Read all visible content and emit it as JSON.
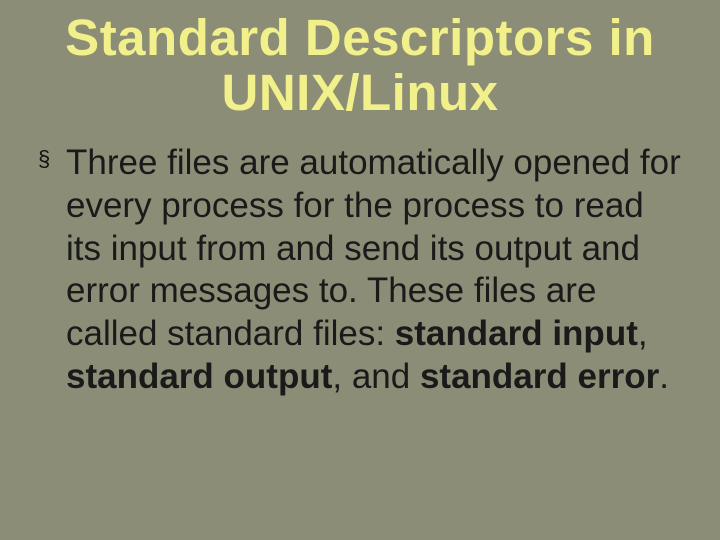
{
  "title": "Standard Descriptors in UNIX/Linux",
  "bullet_marker": "§",
  "body_prefix": "Three files are automatically opened for every process for the process to read its input from and send its output and error messages to. These files are called standard files: ",
  "term1": "standard input",
  "sep1": ", ",
  "term2": "standard output",
  "sep2": ", and ",
  "term3": "standard error",
  "tail": "."
}
